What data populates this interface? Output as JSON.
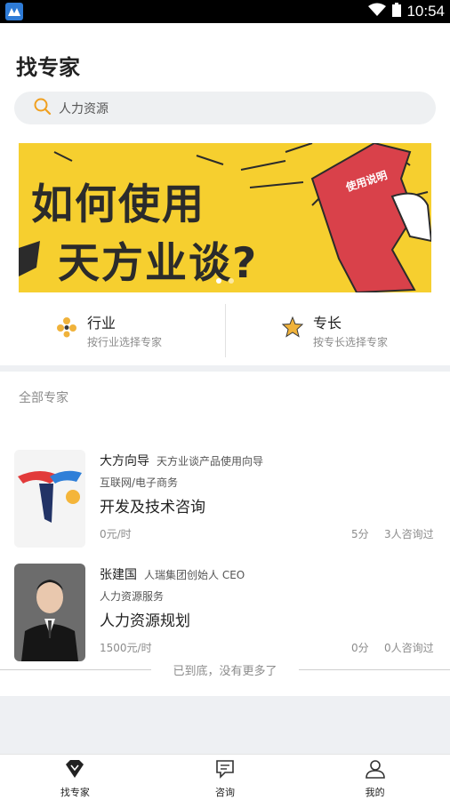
{
  "status_bar": {
    "time": "10:54",
    "app_icon": "app-logo-icon",
    "wifi_icon": "wifi-icon",
    "battery_icon": "battery-icon"
  },
  "page": {
    "title": "找专家"
  },
  "search": {
    "placeholder": "人力资源",
    "icon": "search-icon",
    "icon_color": "#f0a020"
  },
  "banner": {
    "line1": "如何使用",
    "line2": "天方业谈?",
    "scroll_label": "使用说明",
    "background": "#f6cf2f",
    "slide_count": 2,
    "active_slide": 1
  },
  "categories": [
    {
      "title": "行业",
      "subtitle": "按行业选择专家",
      "icon": "industry-icon"
    },
    {
      "title": "专长",
      "subtitle": "按专长选择专家",
      "icon": "star-icon"
    }
  ],
  "experts_section": {
    "title": "全部专家",
    "experts": [
      {
        "name": "大方向导",
        "title": "天方业谈产品使用向导",
        "field": "互联网/电子商务",
        "topic": "开发及技术咨询",
        "price": "0元/时",
        "score": "5分",
        "consults": "3人咨询过",
        "avatar": "brand-logo-avatar"
      },
      {
        "name": "张建国",
        "title": "人瑞集团创始人 CEO",
        "field": "人力资源服务",
        "topic": "人力资源规划",
        "price": "1500元/时",
        "score": "0分",
        "consults": "0人咨询过",
        "avatar": "person-photo-avatar"
      }
    ],
    "end_text": "已到底，没有更多了"
  },
  "tabbar": {
    "tabs": [
      {
        "label": "找专家",
        "icon": "diamond-icon",
        "active": true
      },
      {
        "label": "咨询",
        "icon": "chat-icon",
        "active": false
      },
      {
        "label": "我的",
        "icon": "profile-icon",
        "active": false
      }
    ]
  }
}
